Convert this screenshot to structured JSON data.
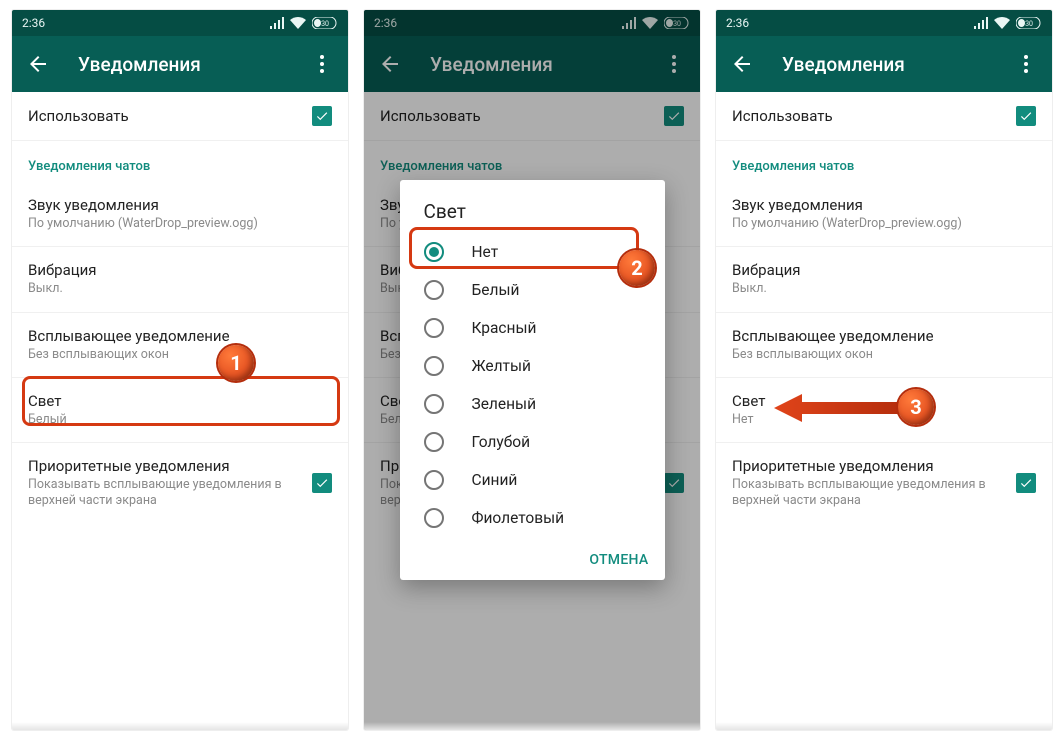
{
  "status": {
    "time": "2:36",
    "battery": "30"
  },
  "appbar": {
    "title": "Уведомления"
  },
  "use": {
    "label": "Использовать"
  },
  "section": {
    "chats": "Уведомления чатов"
  },
  "sound": {
    "title": "Звук уведомления",
    "value": "По умолчанию (WaterDrop_preview.ogg)"
  },
  "vibration": {
    "title": "Вибрация",
    "value": "Выкл."
  },
  "popup": {
    "title": "Всплывающее уведомление",
    "value": "Без всплывающих окон"
  },
  "light_s1": {
    "title": "Свет",
    "value": "Белый"
  },
  "light_s3": {
    "title": "Свет",
    "value": "Нет"
  },
  "priority": {
    "title": "Приоритетные уведомления",
    "sub": "Показывать всплывающие уведомления в верхней части экрана"
  },
  "dialog": {
    "title": "Свет",
    "cancel": "ОТМЕНА",
    "selected": 0,
    "options": [
      "Нет",
      "Белый",
      "Красный",
      "Желтый",
      "Зеленый",
      "Голубой",
      "Синий",
      "Фиолетовый"
    ]
  },
  "anno": {
    "b1": "1",
    "b2": "2",
    "b3": "3"
  }
}
